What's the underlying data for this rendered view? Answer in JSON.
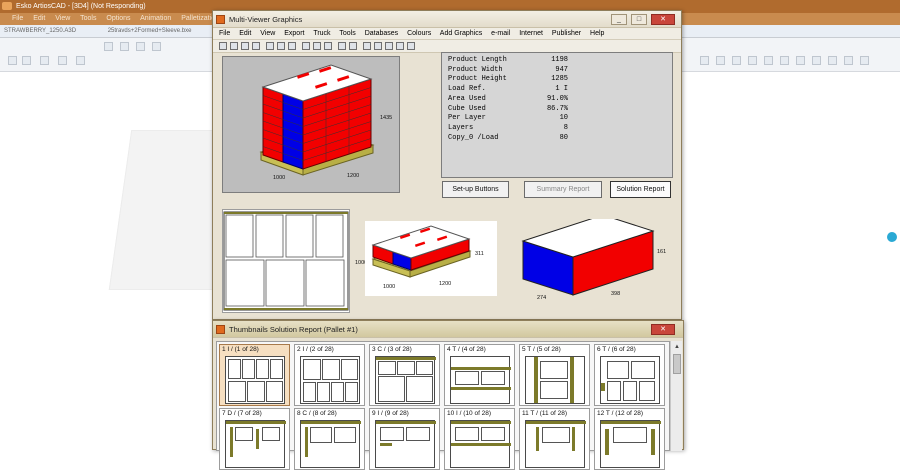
{
  "background_app": {
    "title": "Esko ArtiosCAD - [3D4] (Not Responding)",
    "menu": [
      "File",
      "Edit",
      "View",
      "Tools",
      "Options",
      "Animation",
      "Palletization"
    ],
    "tabs": [
      "STRAWBERRY_1250.A3D",
      "25travds+2Formed+Sleeve.bxe"
    ]
  },
  "multiviewer": {
    "title": "Multi-Viewer Graphics",
    "menu": [
      "File",
      "Edit",
      "View",
      "Export",
      "Truck",
      "Tools",
      "Databases",
      "Colours",
      "Add Graphics",
      "e-mail",
      "Internet",
      "Publisher",
      "Help"
    ],
    "report": [
      {
        "label": "Product Length",
        "value": "1198"
      },
      {
        "label": "Product Width",
        "value": "947"
      },
      {
        "label": "Product Height",
        "value": "1285"
      },
      {
        "label": "Load Ref.",
        "value": "1 I"
      },
      {
        "label": "Area Used",
        "value": "91.0%"
      },
      {
        "label": "Cube Used",
        "value": "86.7%"
      },
      {
        "label": "Per Layer",
        "value": "10"
      },
      {
        "label": "Layers",
        "value": "8"
      },
      {
        "label": "Copy_0 /Load",
        "value": "80"
      }
    ],
    "buttons": {
      "setup": "Set-up Buttons",
      "summary": "Summary Report",
      "solution": "Solution Report"
    },
    "dims": {
      "main_height": "1435",
      "main_w": "1000",
      "main_l": "1200",
      "layer_side": "1000",
      "layer_bottom": "1200",
      "layer3d_h": "311",
      "layer3d_w": "1000",
      "layer3d_l": "1200",
      "box_h": "161",
      "box_w": "274",
      "box_l": "398"
    }
  },
  "thumbnails": {
    "title": "Thumbnails Solution Report (Pallet #1)",
    "items": [
      {
        "label": "1 I / (1 of 28)"
      },
      {
        "label": "2 I / (2 of 28)"
      },
      {
        "label": "3 C / (3 of 28)"
      },
      {
        "label": "4 T / (4 of 28)"
      },
      {
        "label": "5 T / (5 of 28)"
      },
      {
        "label": "6 T / (6 of 28)"
      },
      {
        "label": "7 D / (7 of 28)"
      },
      {
        "label": "8 C / (8 of 28)"
      },
      {
        "label": "9 I / (9 of 28)"
      },
      {
        "label": "10 I / (10 of 28)"
      },
      {
        "label": "11 T / (11 of 28)"
      },
      {
        "label": "12 T / (12 of 28)"
      }
    ]
  },
  "colors": {
    "red": "#f20000",
    "blue": "#0000e6",
    "pallet": "#c8c07a",
    "titlebar": "#b06b2e"
  }
}
